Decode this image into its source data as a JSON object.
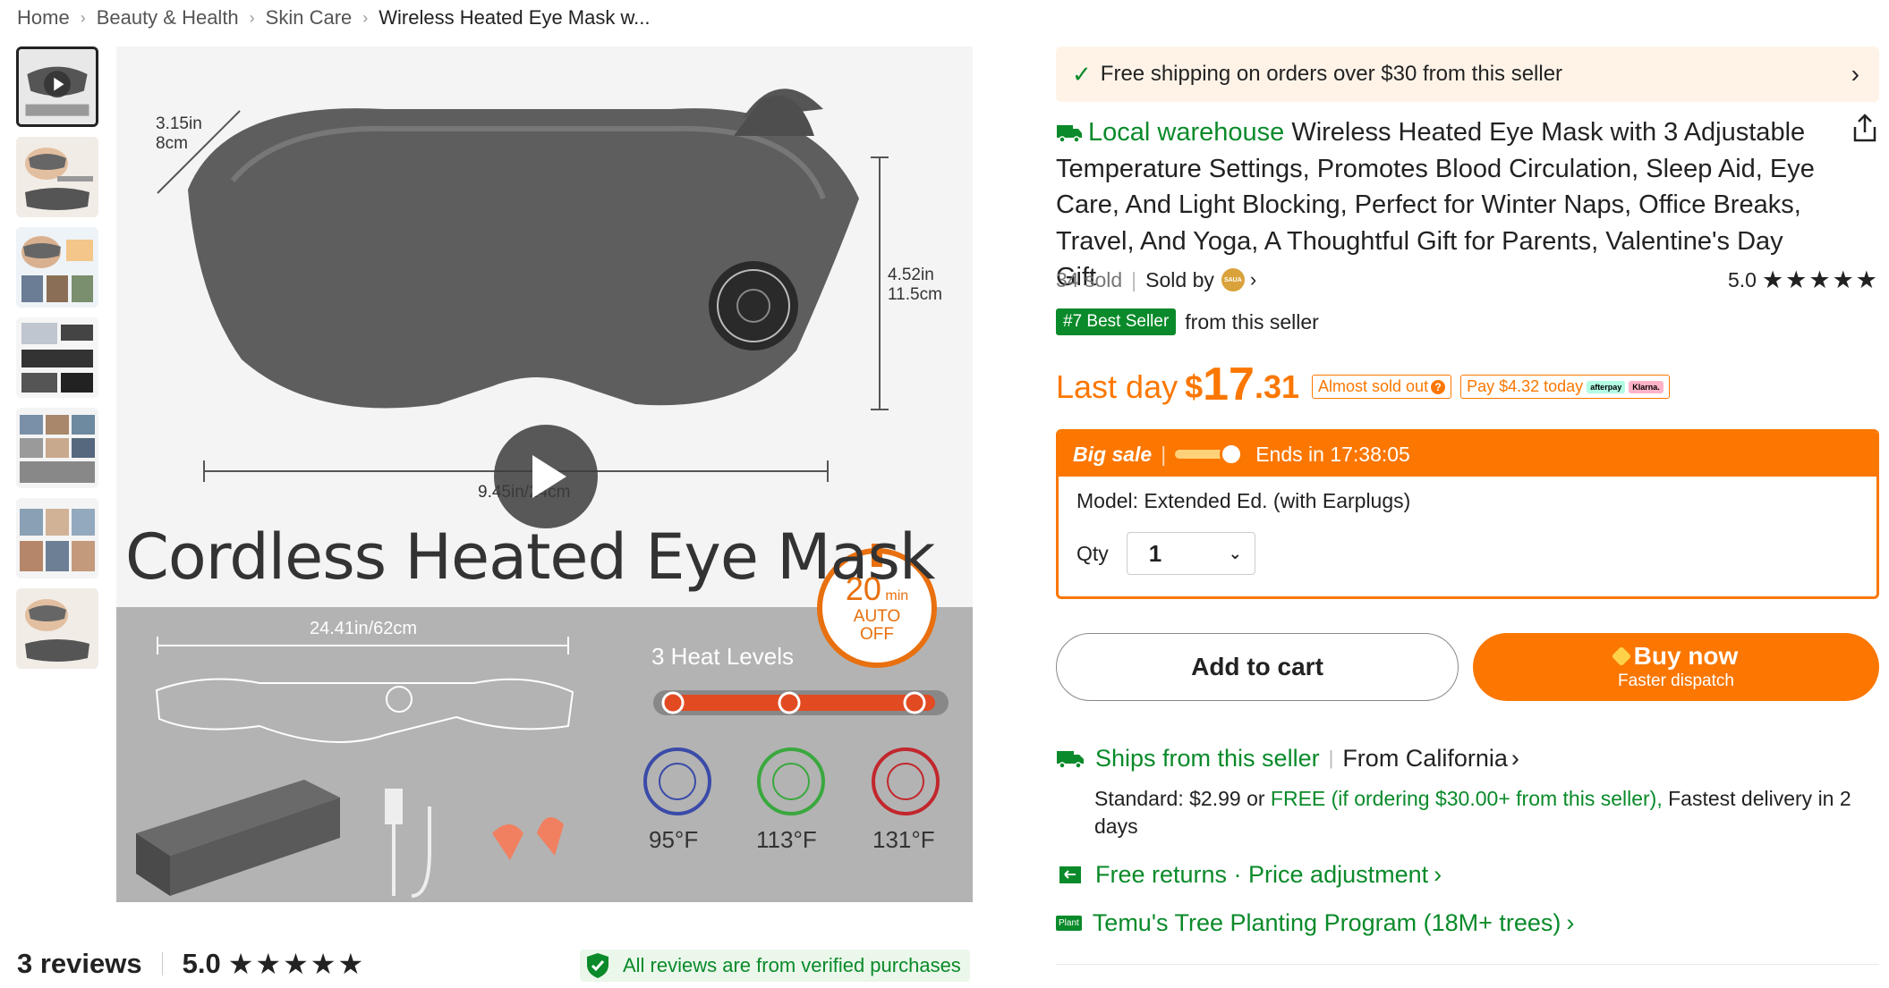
{
  "breadcrumb": {
    "items": [
      "Home",
      "Beauty & Health",
      "Skin Care"
    ],
    "current": "Wireless Heated Eye Mask w..."
  },
  "gallery": {
    "thumbnail_count": 7,
    "main_image": {
      "title": "Cordless Heated Eye Mask",
      "dim_depth": [
        "3.15in",
        "8cm"
      ],
      "dim_height": [
        "4.52in",
        "11.5cm"
      ],
      "dim_width": "9.45in/24cm",
      "dim_length": "24.41in/62cm",
      "timer": {
        "number": "20",
        "unit": "min",
        "line1": "AUTO",
        "line2": "OFF"
      },
      "heat_levels_label": "3 Heat Levels",
      "temps": [
        "95°F",
        "113°F",
        "131°F"
      ],
      "box_text": "Cordless Heated Eye Mask"
    }
  },
  "reviews": {
    "count_label": "3 reviews",
    "score": "5.0",
    "stars": "★★★★★",
    "verified_label": "All reviews are from verified purchases"
  },
  "shipping_banner": {
    "check": "✓",
    "text": "Free shipping on orders over $30 from this seller",
    "chevron": "›"
  },
  "product": {
    "local_label": "Local warehouse",
    "title": "Wireless Heated Eye Mask with 3 Adjustable Temperature Settings, Promotes Blood Circulation, Sleep Aid, Eye Care, And Light Blocking, Perfect for Winter Naps, Office Breaks, Travel, And Yoga, A Thoughtful Gift for Parents, Valentine's Day Gift",
    "sold": "34 sold",
    "sold_by": "Sold by",
    "seller_logo_text": "SAUA",
    "rating": "5.0",
    "stars": "★★★★★",
    "best_seller_badge": "#7 Best Seller",
    "best_seller_suffix": "from this seller"
  },
  "price": {
    "label": "Last day",
    "currency": "$",
    "integer": "17",
    "decimal": ".31",
    "almost_sold_out": "Almost sold out",
    "pay_today": "Pay $4.32 today",
    "afterpay": "afterpay",
    "klarna": "Klarna."
  },
  "sale": {
    "big_sale": "Big sale",
    "ends": "Ends in 17:38:05",
    "model_label": "Model: Extended Ed. (with Earplugs)",
    "qty_label": "Qty",
    "qty_value": "1"
  },
  "actions": {
    "add_to_cart": "Add to cart",
    "buy_now": "Buy now",
    "buy_now_sub": "Faster dispatch"
  },
  "shipping": {
    "ships_from": "Ships from this seller",
    "from_location": "From California",
    "standard_prefix": "Standard: $2.99 or ",
    "free_text": "FREE (if ordering $30.00+ from this seller),",
    "fastest": " Fastest delivery in 2 days"
  },
  "returns": {
    "label": "Free returns · Price adjustment"
  },
  "tree": {
    "badge": "Plant",
    "label": "Temu's Tree Planting Program (18M+ trees)"
  },
  "colors": {
    "accent_orange": "#fb7701",
    "green": "#0a8a2a",
    "banner_bg": "#fff3e8"
  }
}
